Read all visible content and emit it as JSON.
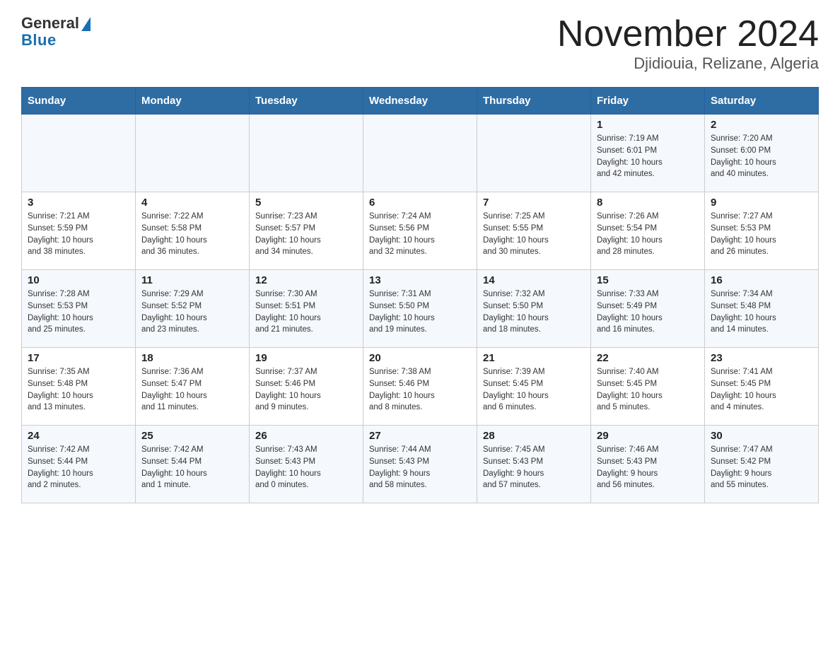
{
  "header": {
    "logo_general": "General",
    "logo_blue": "Blue",
    "month_title": "November 2024",
    "location": "Djidiouia, Relizane, Algeria"
  },
  "weekdays": [
    "Sunday",
    "Monday",
    "Tuesday",
    "Wednesday",
    "Thursday",
    "Friday",
    "Saturday"
  ],
  "weeks": [
    [
      {
        "day": "",
        "info": ""
      },
      {
        "day": "",
        "info": ""
      },
      {
        "day": "",
        "info": ""
      },
      {
        "day": "",
        "info": ""
      },
      {
        "day": "",
        "info": ""
      },
      {
        "day": "1",
        "info": "Sunrise: 7:19 AM\nSunset: 6:01 PM\nDaylight: 10 hours\nand 42 minutes."
      },
      {
        "day": "2",
        "info": "Sunrise: 7:20 AM\nSunset: 6:00 PM\nDaylight: 10 hours\nand 40 minutes."
      }
    ],
    [
      {
        "day": "3",
        "info": "Sunrise: 7:21 AM\nSunset: 5:59 PM\nDaylight: 10 hours\nand 38 minutes."
      },
      {
        "day": "4",
        "info": "Sunrise: 7:22 AM\nSunset: 5:58 PM\nDaylight: 10 hours\nand 36 minutes."
      },
      {
        "day": "5",
        "info": "Sunrise: 7:23 AM\nSunset: 5:57 PM\nDaylight: 10 hours\nand 34 minutes."
      },
      {
        "day": "6",
        "info": "Sunrise: 7:24 AM\nSunset: 5:56 PM\nDaylight: 10 hours\nand 32 minutes."
      },
      {
        "day": "7",
        "info": "Sunrise: 7:25 AM\nSunset: 5:55 PM\nDaylight: 10 hours\nand 30 minutes."
      },
      {
        "day": "8",
        "info": "Sunrise: 7:26 AM\nSunset: 5:54 PM\nDaylight: 10 hours\nand 28 minutes."
      },
      {
        "day": "9",
        "info": "Sunrise: 7:27 AM\nSunset: 5:53 PM\nDaylight: 10 hours\nand 26 minutes."
      }
    ],
    [
      {
        "day": "10",
        "info": "Sunrise: 7:28 AM\nSunset: 5:53 PM\nDaylight: 10 hours\nand 25 minutes."
      },
      {
        "day": "11",
        "info": "Sunrise: 7:29 AM\nSunset: 5:52 PM\nDaylight: 10 hours\nand 23 minutes."
      },
      {
        "day": "12",
        "info": "Sunrise: 7:30 AM\nSunset: 5:51 PM\nDaylight: 10 hours\nand 21 minutes."
      },
      {
        "day": "13",
        "info": "Sunrise: 7:31 AM\nSunset: 5:50 PM\nDaylight: 10 hours\nand 19 minutes."
      },
      {
        "day": "14",
        "info": "Sunrise: 7:32 AM\nSunset: 5:50 PM\nDaylight: 10 hours\nand 18 minutes."
      },
      {
        "day": "15",
        "info": "Sunrise: 7:33 AM\nSunset: 5:49 PM\nDaylight: 10 hours\nand 16 minutes."
      },
      {
        "day": "16",
        "info": "Sunrise: 7:34 AM\nSunset: 5:48 PM\nDaylight: 10 hours\nand 14 minutes."
      }
    ],
    [
      {
        "day": "17",
        "info": "Sunrise: 7:35 AM\nSunset: 5:48 PM\nDaylight: 10 hours\nand 13 minutes."
      },
      {
        "day": "18",
        "info": "Sunrise: 7:36 AM\nSunset: 5:47 PM\nDaylight: 10 hours\nand 11 minutes."
      },
      {
        "day": "19",
        "info": "Sunrise: 7:37 AM\nSunset: 5:46 PM\nDaylight: 10 hours\nand 9 minutes."
      },
      {
        "day": "20",
        "info": "Sunrise: 7:38 AM\nSunset: 5:46 PM\nDaylight: 10 hours\nand 8 minutes."
      },
      {
        "day": "21",
        "info": "Sunrise: 7:39 AM\nSunset: 5:45 PM\nDaylight: 10 hours\nand 6 minutes."
      },
      {
        "day": "22",
        "info": "Sunrise: 7:40 AM\nSunset: 5:45 PM\nDaylight: 10 hours\nand 5 minutes."
      },
      {
        "day": "23",
        "info": "Sunrise: 7:41 AM\nSunset: 5:45 PM\nDaylight: 10 hours\nand 4 minutes."
      }
    ],
    [
      {
        "day": "24",
        "info": "Sunrise: 7:42 AM\nSunset: 5:44 PM\nDaylight: 10 hours\nand 2 minutes."
      },
      {
        "day": "25",
        "info": "Sunrise: 7:42 AM\nSunset: 5:44 PM\nDaylight: 10 hours\nand 1 minute."
      },
      {
        "day": "26",
        "info": "Sunrise: 7:43 AM\nSunset: 5:43 PM\nDaylight: 10 hours\nand 0 minutes."
      },
      {
        "day": "27",
        "info": "Sunrise: 7:44 AM\nSunset: 5:43 PM\nDaylight: 9 hours\nand 58 minutes."
      },
      {
        "day": "28",
        "info": "Sunrise: 7:45 AM\nSunset: 5:43 PM\nDaylight: 9 hours\nand 57 minutes."
      },
      {
        "day": "29",
        "info": "Sunrise: 7:46 AM\nSunset: 5:43 PM\nDaylight: 9 hours\nand 56 minutes."
      },
      {
        "day": "30",
        "info": "Sunrise: 7:47 AM\nSunset: 5:42 PM\nDaylight: 9 hours\nand 55 minutes."
      }
    ]
  ]
}
